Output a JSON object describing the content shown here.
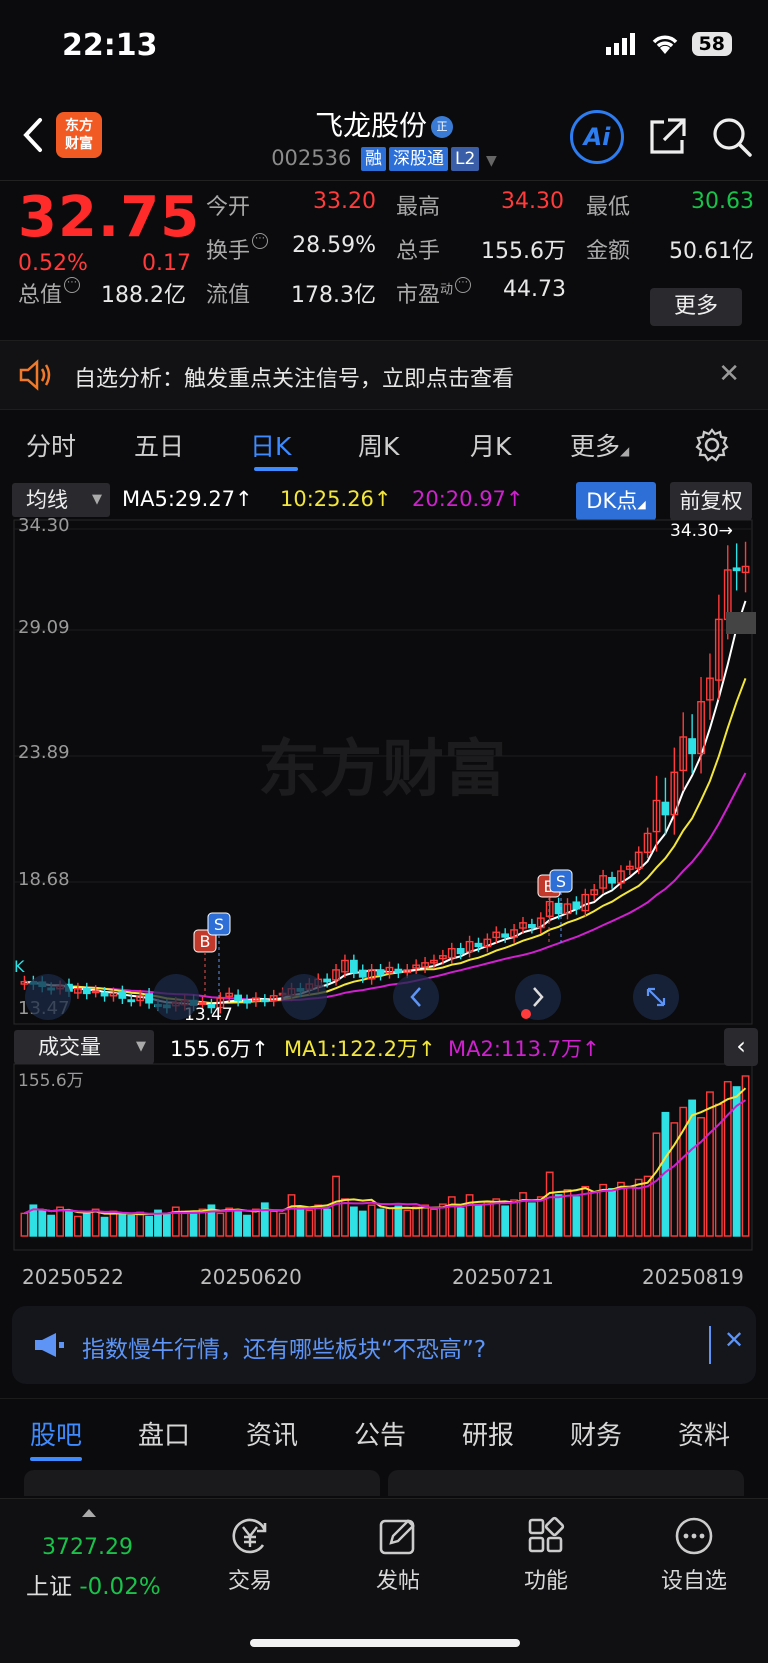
{
  "status": {
    "time": "22:13",
    "battery": "58"
  },
  "header": {
    "name": "飞龙股份",
    "badge": "正",
    "code": "002536",
    "tags": [
      "融",
      "深股通",
      "L2"
    ],
    "logo_line1": "东方",
    "logo_line2": "财富",
    "ai_label": "Ai"
  },
  "quote": {
    "price": "32.75",
    "change_pct": "0.52%",
    "change": "0.17",
    "open_label": "今开",
    "open": "33.20",
    "high_label": "最高",
    "high": "34.30",
    "low_label": "最低",
    "low": "30.63",
    "turnover_label": "换手",
    "turnover": "28.59%",
    "volume_label": "总手",
    "volume": "155.6万",
    "amount_label": "金额",
    "amount": "50.61亿",
    "mktcap_label": "总值",
    "mktcap": "188.2亿",
    "float_label": "流值",
    "float": "178.3亿",
    "pe_label": "市盈",
    "pe_sup": "动",
    "pe": "44.73",
    "more": "更多"
  },
  "alert": {
    "text": "自选分析：触发重点关注信号，立即点击查看"
  },
  "tabs": [
    "分时",
    "五日",
    "日K",
    "周K",
    "月K",
    "更多"
  ],
  "toolbar": {
    "ma_select": "均线",
    "ma5": "MA5:29.27↑",
    "ma10": "10:25.26↑",
    "ma20": "20:20.97↑",
    "dk": "DK点",
    "fq": "前复权"
  },
  "vol_toolbar": {
    "select": "成交量",
    "vol": "155.6万↑",
    "ma1": "MA1:122.2万↑",
    "ma2": "MA2:113.7万↑"
  },
  "colors": {
    "up": "#ff3b3b",
    "down": "#19c24a",
    "vol_down": "#2fe0e4",
    "ma5": "#ffffff",
    "ma10": "#f2e63c",
    "ma20": "#d020d0",
    "accent": "#3d8bff"
  },
  "chart_data": {
    "type": "candlestick",
    "y_ticks": [
      "34.30",
      "29.09",
      "23.89",
      "18.68",
      "13.47"
    ],
    "ylim": [
      13.47,
      34.3
    ],
    "high_marker": "34.30→",
    "low_marker": "13.47",
    "x_labels": [
      "20250522",
      "20250620",
      "20250721",
      "20250819"
    ],
    "watermark": "东方财富",
    "marker_b": "B",
    "marker_s": "S",
    "k_marker": "K",
    "closes": [
      15.1,
      15.0,
      14.9,
      14.8,
      14.9,
      14.7,
      14.8,
      14.6,
      14.7,
      14.5,
      14.6,
      14.4,
      14.3,
      14.5,
      14.2,
      14.1,
      14.0,
      14.2,
      14.3,
      14.1,
      14.2,
      14.0,
      14.4,
      14.6,
      14.3,
      14.2,
      14.4,
      14.3,
      14.5,
      14.6,
      14.8,
      14.7,
      15.0,
      15.2,
      15.1,
      15.6,
      16.0,
      15.5,
      15.3,
      15.6,
      15.4,
      15.7,
      15.5,
      15.6,
      15.8,
      15.9,
      16.0,
      16.2,
      16.5,
      16.3,
      16.8,
      16.6,
      16.9,
      17.2,
      17.0,
      17.3,
      17.6,
      17.4,
      17.8,
      18.5,
      18.0,
      18.4,
      18.2,
      18.8,
      19.0,
      19.6,
      19.3,
      19.8,
      20.0,
      20.6,
      21.4,
      22.8,
      22.2,
      24.0,
      25.5,
      24.8,
      27.0,
      28.0,
      30.5,
      32.6,
      32.58,
      32.75
    ],
    "volume_ylabel": "155.6万",
    "volume_max": 155.6,
    "volumes": [
      22,
      30,
      25,
      20,
      28,
      24,
      19,
      22,
      26,
      18,
      24,
      21,
      20,
      23,
      19,
      25,
      22,
      28,
      24,
      21,
      26,
      30,
      22,
      27,
      24,
      20,
      26,
      32,
      24,
      22,
      40,
      28,
      25,
      30,
      26,
      58,
      36,
      28,
      24,
      30,
      26,
      27,
      29,
      25,
      28,
      30,
      26,
      31,
      38,
      27,
      40,
      30,
      33,
      36,
      29,
      35,
      42,
      32,
      38,
      62,
      40,
      45,
      38,
      48,
      43,
      50,
      46,
      52,
      48,
      55,
      58,
      100,
      120,
      110,
      125,
      132,
      115,
      140,
      128,
      150,
      145,
      155.6
    ]
  },
  "bottom_alert": {
    "text": "指数慢牛行情，还有哪些板块“不恐高”?"
  },
  "sub_tabs": [
    "股吧",
    "盘口",
    "资讯",
    "公告",
    "研报",
    "财务",
    "资料"
  ],
  "bottom_bar": {
    "index_value": "3727.29",
    "index_name": "上证",
    "index_change": "-0.02%",
    "items": [
      "交易",
      "发帖",
      "功能",
      "设自选"
    ]
  }
}
